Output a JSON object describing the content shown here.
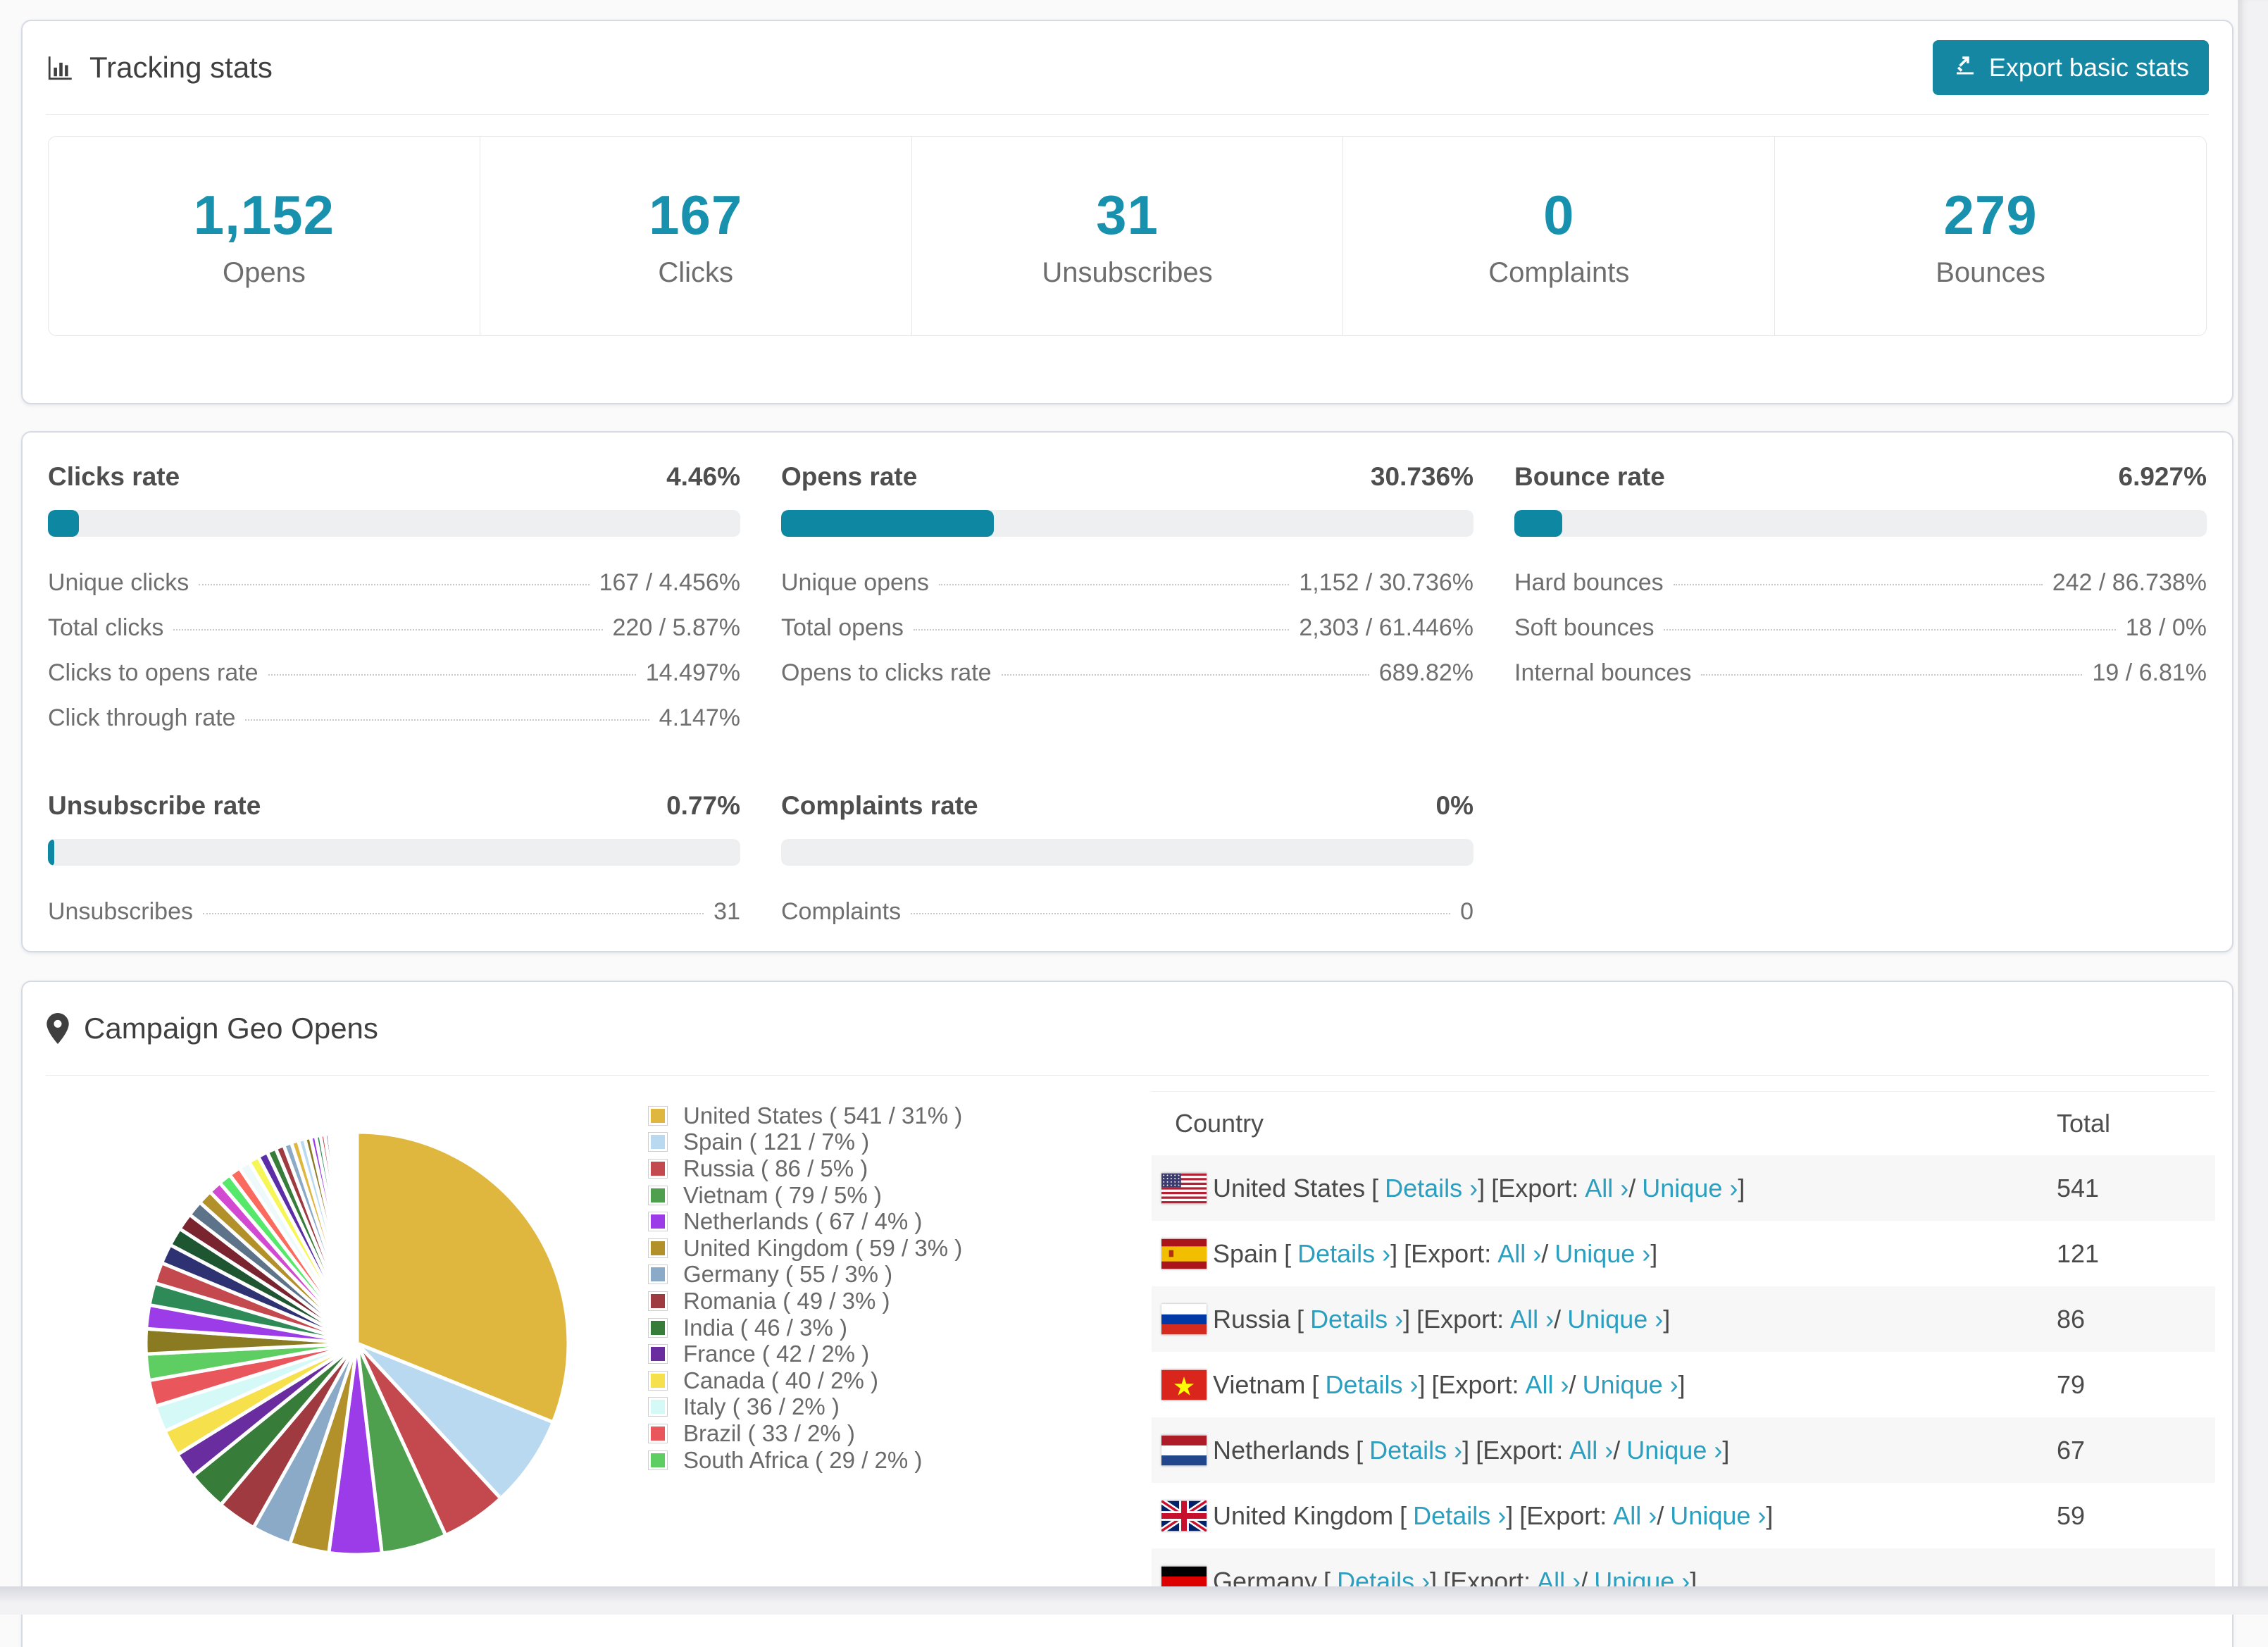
{
  "tracking": {
    "title": "Tracking stats",
    "export_button": "Export basic stats"
  },
  "summary": [
    {
      "value": "1,152",
      "label": "Opens"
    },
    {
      "value": "167",
      "label": "Clicks"
    },
    {
      "value": "31",
      "label": "Unsubscribes"
    },
    {
      "value": "0",
      "label": "Complaints"
    },
    {
      "value": "279",
      "label": "Bounces"
    }
  ],
  "rates": [
    {
      "id": "clicks",
      "title": "Clicks rate",
      "value": "4.46%",
      "percent": 4.46,
      "rows": [
        {
          "label": "Unique clicks",
          "value": "167 / 4.456%"
        },
        {
          "label": "Total clicks",
          "value": "220 / 5.87%"
        },
        {
          "label": "Clicks to opens rate",
          "value": "14.497%"
        },
        {
          "label": "Click through rate",
          "value": "4.147%"
        }
      ]
    },
    {
      "id": "opens",
      "title": "Opens rate",
      "value": "30.736%",
      "percent": 30.736,
      "rows": [
        {
          "label": "Unique opens",
          "value": "1,152 / 30.736%"
        },
        {
          "label": "Total opens",
          "value": "2,303 / 61.446%"
        },
        {
          "label": "Opens to clicks rate",
          "value": "689.82%"
        }
      ]
    },
    {
      "id": "bounce",
      "title": "Bounce rate",
      "value": "6.927%",
      "percent": 6.927,
      "rows": [
        {
          "label": "Hard bounces",
          "value": "242 / 86.738%"
        },
        {
          "label": "Soft bounces",
          "value": "18 / 0%"
        },
        {
          "label": "Internal bounces",
          "value": "19 / 6.81%"
        }
      ]
    },
    {
      "id": "unsubscribe",
      "title": "Unsubscribe rate",
      "value": "0.77%",
      "percent": 0.77,
      "rows": [
        {
          "label": "Unsubscribes",
          "value": "31"
        }
      ]
    },
    {
      "id": "complaints",
      "title": "Complaints rate",
      "value": "0%",
      "percent": 0,
      "rows": [
        {
          "label": "Complaints",
          "value": "0"
        }
      ]
    }
  ],
  "geo": {
    "title": "Campaign Geo Opens",
    "table": {
      "columns": [
        "Country",
        "Total"
      ],
      "link_labels": {
        "open": "[",
        "close": "]",
        "details": "Details ›",
        "export": "Export:",
        "all": "All ›",
        "slash": "/",
        "unique": "Unique ›"
      },
      "rows": [
        {
          "country": "United States",
          "flag": "us",
          "total": "541"
        },
        {
          "country": "Spain",
          "flag": "es",
          "total": "121"
        },
        {
          "country": "Russia",
          "flag": "ru",
          "total": "86"
        },
        {
          "country": "Vietnam",
          "flag": "vn",
          "total": "79"
        },
        {
          "country": "Netherlands",
          "flag": "nl",
          "total": "67"
        },
        {
          "country": "United Kingdom",
          "flag": "gb",
          "total": "59"
        },
        {
          "country": "Germany",
          "flag": "de",
          "total": ""
        }
      ]
    }
  },
  "chart_data": {
    "type": "pie",
    "title": "Campaign Geo Opens",
    "legend_position": "right",
    "labels": [
      "United States",
      "Spain",
      "Russia",
      "Vietnam",
      "Netherlands",
      "United Kingdom",
      "Germany",
      "Romania",
      "India",
      "France",
      "Canada",
      "Italy",
      "Brazil",
      "South Africa"
    ],
    "values": [
      541,
      121,
      86,
      79,
      67,
      59,
      55,
      49,
      46,
      42,
      40,
      36,
      33,
      29
    ],
    "percents": [
      31,
      7,
      5,
      5,
      4,
      3,
      3,
      3,
      3,
      2,
      2,
      2,
      2,
      2
    ],
    "colors": [
      "#e0b73e",
      "#b8d9f0",
      "#c4494f",
      "#4ea04f",
      "#9b3ce8",
      "#b2912a",
      "#8aaac8",
      "#9e3a40",
      "#377c38",
      "#6a2da0",
      "#f6e04b",
      "#d5f9f7",
      "#e9565b",
      "#5fce62"
    ],
    "legend_labels": [
      "United States ( 541 / 31% )",
      "Spain ( 121 / 7% )",
      "Russia ( 86 / 5% )",
      "Vietnam ( 79 / 5% )",
      "Netherlands ( 67 / 4% )",
      "United Kingdom ( 59 / 3% )",
      "Germany ( 55 / 3% )",
      "Romania ( 49 / 3% )",
      "India ( 46 / 3% )",
      "France ( 42 / 2% )",
      "Canada ( 40 / 2% )",
      "Italy ( 36 / 2% )",
      "Brazil ( 33 / 2% )",
      "South Africa ( 29 / 2% )"
    ],
    "others_unlabeled_percents": [
      1.9,
      1.8,
      1.7,
      1.6,
      1.5,
      1.4,
      1.3,
      1.2,
      1.1,
      1.0,
      0.95,
      0.9,
      0.85,
      0.8,
      0.75,
      0.7,
      0.65,
      0.6,
      0.55,
      0.5,
      0.45,
      0.4,
      0.36,
      0.33,
      0.3,
      0.27,
      0.24,
      0.21,
      0.19,
      0.17,
      0.15,
      0.13,
      0.12,
      0.1,
      0.09,
      0.08,
      0.07,
      0.06,
      0.05,
      0.05,
      0.04,
      0.04,
      0.03,
      0.03,
      0.02
    ],
    "others_palette": [
      "#8a7a22",
      "#9b3ce8",
      "#2e8b57",
      "#c4494f",
      "#2e3272",
      "#1e5631",
      "#7a2430",
      "#5d7389",
      "#b2912a",
      "#d24ad2",
      "#56e86b",
      "#fa6a5f",
      "#eef9fc",
      "#f7f657",
      "#5b2ea8",
      "#377c38",
      "#9e3a40",
      "#8aaac8",
      "#e0b73e",
      "#b8d9f0"
    ]
  }
}
